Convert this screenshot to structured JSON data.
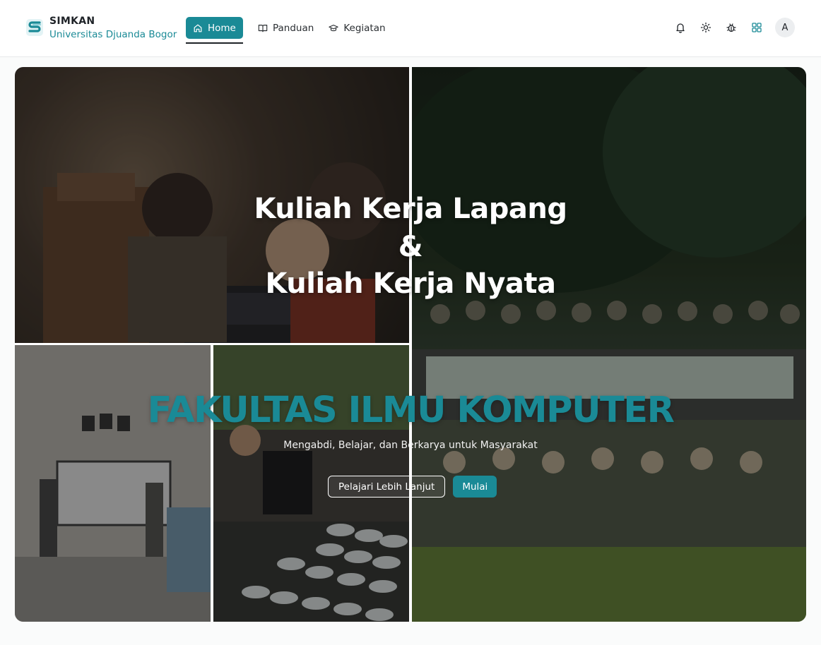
{
  "brand": {
    "name": "SIMKAN",
    "subtitle": "Universitas Djuanda Bogor"
  },
  "nav": [
    {
      "label": "Home",
      "icon": "home-icon",
      "active": true
    },
    {
      "label": "Panduan",
      "icon": "book-icon",
      "active": false
    },
    {
      "label": "Kegiatan",
      "icon": "graduation-cap-icon",
      "active": false
    }
  ],
  "toolbar": {
    "icons": [
      "bell-icon",
      "sun-icon",
      "bug-icon",
      "grid-icon"
    ],
    "avatar_initial": "A"
  },
  "hero": {
    "title_line1": "Kuliah Kerja Lapang",
    "title_line2": "&",
    "title_line3": "Kuliah Kerja Nyata",
    "faculty": "FAKULTAS ILMU KOMPUTER",
    "tagline": "Mengabdi, Belajar, dan Berkarya untuk Masyarakat",
    "secondary_button": "Pelajari Lebih Lanjut",
    "primary_button": "Mulai"
  },
  "colors": {
    "accent": "#1a8a96",
    "text": "#1f2328",
    "background": "#fafbfb"
  }
}
